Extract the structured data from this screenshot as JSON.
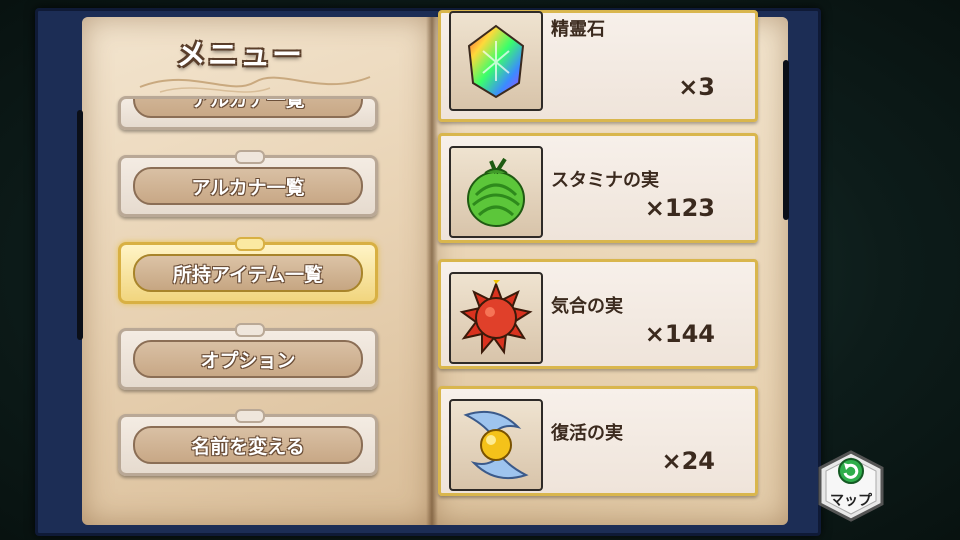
{
  "menu": {
    "title": "メニュー",
    "items": [
      {
        "label": "アルカナ一覧",
        "state": "partial"
      },
      {
        "label": "アルカナ一覧",
        "state": "normal"
      },
      {
        "label": "所持アイテム一覧",
        "state": "selected"
      },
      {
        "label": "オプション",
        "state": "normal"
      },
      {
        "label": "名前を変える",
        "state": "normal"
      }
    ]
  },
  "items": [
    {
      "name": "精霊石",
      "count": "×3",
      "icon": "rainbow-crystal-icon"
    },
    {
      "name": "スタミナの実",
      "count": "×123",
      "icon": "green-melon-fruit-icon"
    },
    {
      "name": "気合の実",
      "count": "×144",
      "icon": "red-spiky-fruit-icon"
    },
    {
      "name": "復活の実",
      "count": "×24",
      "icon": "winged-golden-fruit-icon"
    }
  ],
  "map_button": {
    "label": "マップ",
    "icon": "refresh-arrow-icon"
  },
  "colors": {
    "frame": "#1c2d55",
    "gold": "#d9b64d",
    "page": "#f3e5cf"
  }
}
